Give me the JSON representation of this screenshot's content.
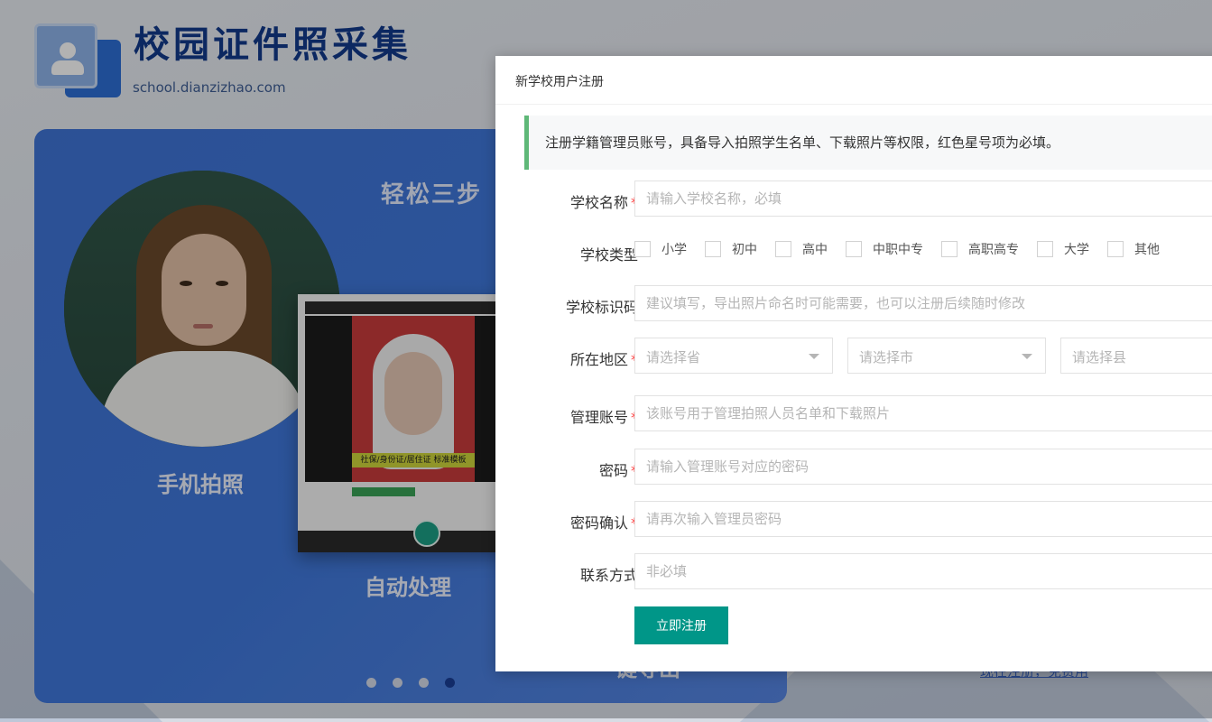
{
  "site": {
    "title": "校园证件照采集",
    "url": "school.dianzizhao.com"
  },
  "banner": {
    "title": "轻松三步",
    "captions": [
      "手机拍照",
      "自动处理",
      "一键导出"
    ],
    "phone_tag": "社保/身份证/居住证 标准模板",
    "slides_total": 4,
    "active_slide": 4
  },
  "background_link": "现在注册，免费用",
  "dialog": {
    "title": "新学校用户注册",
    "notice": "注册学籍管理员账号，具备导入拍照学生名单、下载照片等权限，红色星号项为必填。",
    "fields": {
      "school_name": {
        "label": "学校名称",
        "required": "*",
        "placeholder": "请输入学校名称，必填"
      },
      "school_type": {
        "label": "学校类型",
        "options": [
          "小学",
          "初中",
          "高中",
          "中职中专",
          "高职高专",
          "大学",
          "其他"
        ]
      },
      "school_code": {
        "label": "学校标识码",
        "placeholder": "建议填写，导出照片命名时可能需要，也可以注册后续随时修改"
      },
      "region": {
        "label": "所在地区",
        "required": "*",
        "province": "请选择省",
        "city": "请选择市",
        "county": "请选择县"
      },
      "account": {
        "label": "管理账号",
        "required": "*",
        "placeholder": "该账号用于管理拍照人员名单和下载照片"
      },
      "password": {
        "label": "密码",
        "required": "*",
        "placeholder": "请输入管理账号对应的密码"
      },
      "password_confirm": {
        "label": "密码确认",
        "required": "*",
        "placeholder": "请再次输入管理员密码"
      },
      "contact": {
        "label": "联系方式",
        "placeholder": "非必填"
      }
    },
    "submit_label": "立即注册"
  }
}
